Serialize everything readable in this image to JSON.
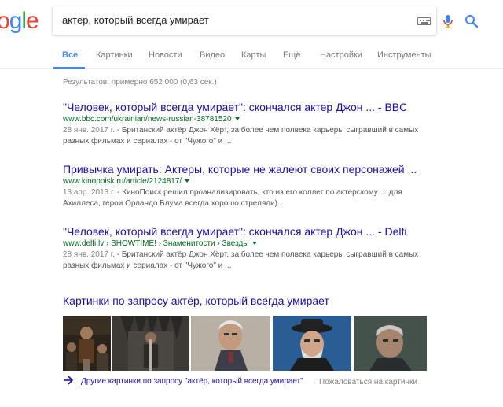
{
  "logo": {
    "letters": [
      "o",
      "g",
      "l",
      "e"
    ],
    "colors": [
      "#ea4335",
      "#4285f4",
      "#34a853",
      "#ea4335"
    ]
  },
  "search": {
    "query": "актёр, который всегда умирает"
  },
  "tabs": [
    {
      "label": "Все",
      "active": true
    },
    {
      "label": "Картинки"
    },
    {
      "label": "Новости"
    },
    {
      "label": "Видео"
    },
    {
      "label": "Карты"
    },
    {
      "label": "Ещё"
    },
    {
      "label": "Настройки"
    },
    {
      "label": "Инструменты"
    }
  ],
  "stats": "Результатов: примерно 652 000 (0,63 сек.)",
  "results": [
    {
      "title": "\"Человек, который всегда умирает\": скончался актер Джон ... - BBC",
      "url": "www.bbc.com/ukrainian/news-russian-38781520",
      "date": "28 янв. 2017 г.",
      "snippet_line1_rest": " - Британский актёр Джон Хёрт, за более чем полвека карьеры сыгравший в самых",
      "snippet_line2": "разных фильмах и сериалах - от \"Чужого\" и ..."
    },
    {
      "title": "Привычка умирать: Актеры, которые не жалеют своих персонажей ...",
      "url": "www.kinopoisk.ru/article/2124817/",
      "date": "13 апр. 2013 г.",
      "snippet_line1_rest": " - КиноПоиск решил проанализировать, кто из его коллег по актерскому ... для",
      "snippet_line2": "Ахиллеса, герои Орландо Блума всегда хорошо стреляли)."
    },
    {
      "title": "\"Человек, который всегда умирает\": скончался актер Джон ... - Delfi",
      "url": "www.delfi.lv › SHOWTIME! › Знаменитости › Звезды",
      "date": "28 янв. 2017 г.",
      "snippet_line1_rest": " - Британский актёр Джон Хёрт, за более чем полвека карьеры сыгравший в самых",
      "snippet_line2": "разных фильмах и сериалах - от \"Чужого\" и ..."
    }
  ],
  "images": {
    "heading": "Картинки по запросу актёр, который всегда умирает",
    "more_label": "Другие картинки по запросу \"актёр, который всегда умирает\"",
    "report_label": "Пожаловаться на картинки"
  }
}
